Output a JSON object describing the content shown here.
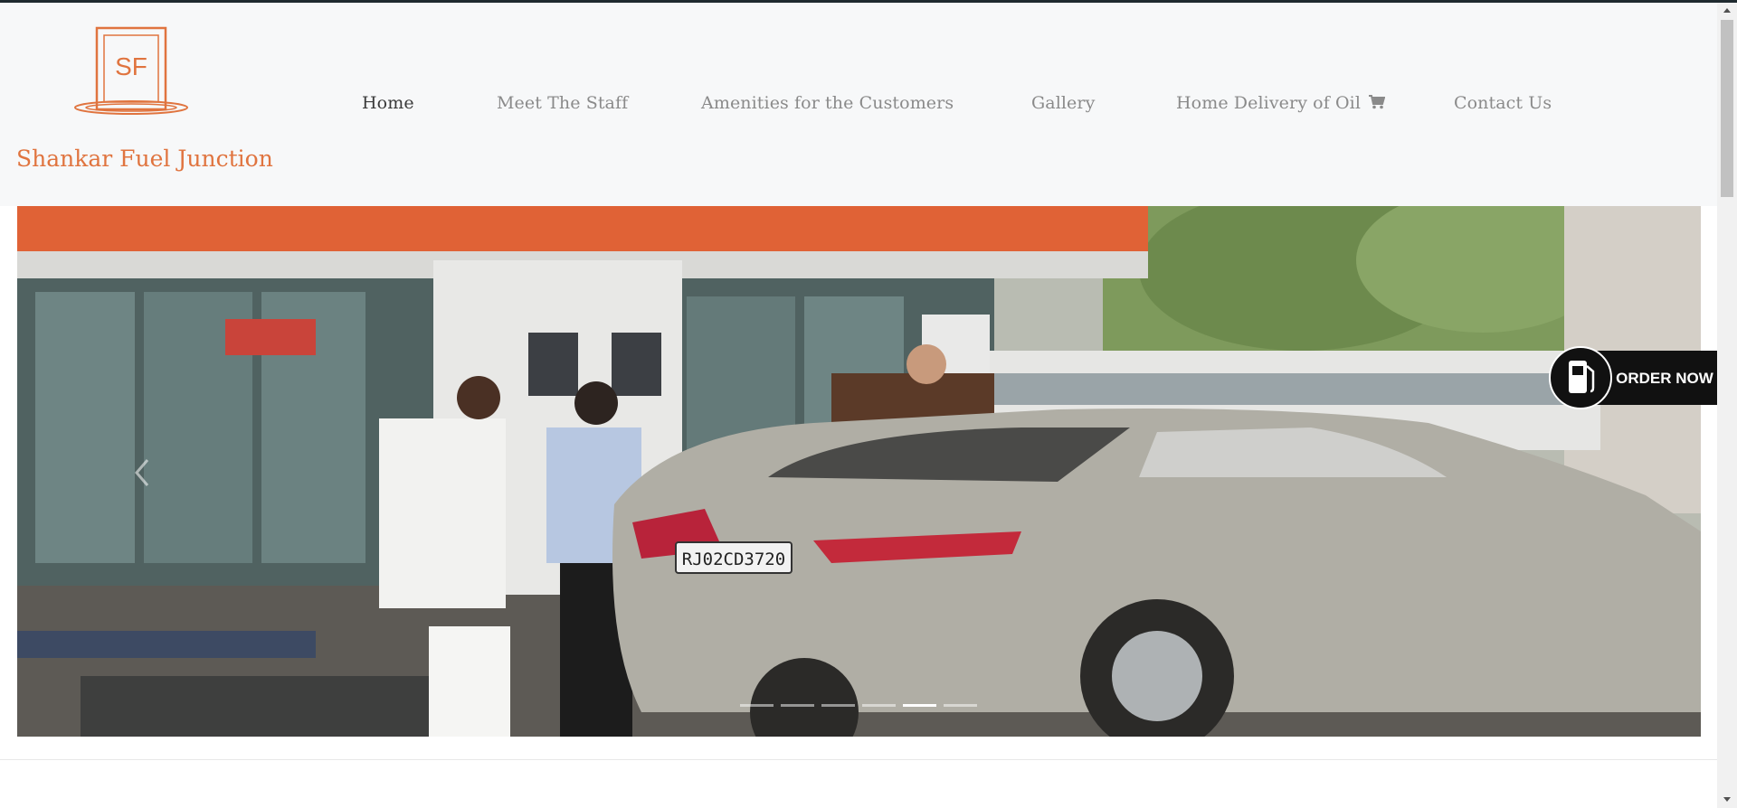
{
  "brand": {
    "logo_text": "SF",
    "name": "Shankar Fuel Junction"
  },
  "nav": {
    "items": [
      {
        "label": "Home",
        "active": true
      },
      {
        "label": "Meet The Staff",
        "active": false
      },
      {
        "label": "Amenities for the Customers",
        "active": false
      },
      {
        "label": "Gallery",
        "active": false
      },
      {
        "label": "Home Delivery of Oil",
        "active": false,
        "icon": "cart-icon"
      },
      {
        "label": "Contact Us",
        "active": false
      }
    ]
  },
  "hero": {
    "plate_text": "RJ02CD3720",
    "slide_count": 6,
    "active_slide": 5
  },
  "order_button": {
    "label": "ORDER NOW",
    "icon": "fuel-pump-icon"
  },
  "colors": {
    "accent": "#e0743f",
    "nav_text": "#8a8a8a",
    "nav_active": "#3a3a3a",
    "header_bg": "#f7f8f9"
  }
}
